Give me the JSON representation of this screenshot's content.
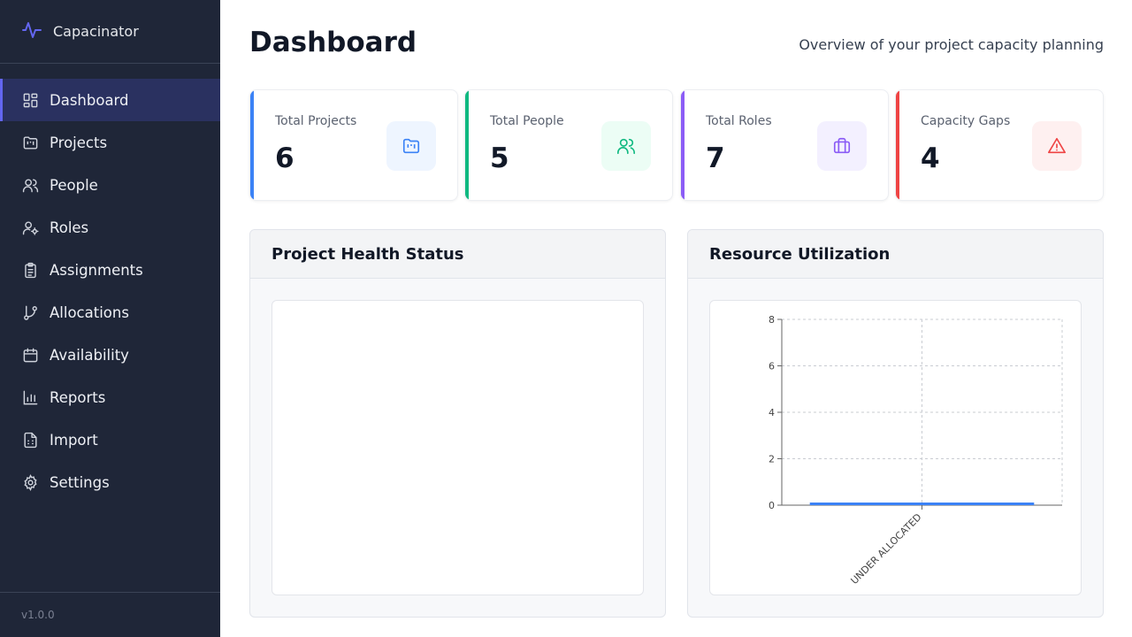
{
  "app": {
    "name": "Capacinator",
    "version": "v1.0.0",
    "accent": "#6366f1"
  },
  "sidebar": {
    "items": [
      {
        "label": "Dashboard",
        "icon": "dashboard-icon",
        "active": true
      },
      {
        "label": "Projects",
        "icon": "folder-kanban-icon"
      },
      {
        "label": "People",
        "icon": "users-icon"
      },
      {
        "label": "Roles",
        "icon": "user-cog-icon"
      },
      {
        "label": "Assignments",
        "icon": "clipboard-list-icon"
      },
      {
        "label": "Allocations",
        "icon": "git-branch-icon"
      },
      {
        "label": "Availability",
        "icon": "calendar-icon"
      },
      {
        "label": "Reports",
        "icon": "bar-chart-icon"
      },
      {
        "label": "Import",
        "icon": "file-spreadsheet-icon"
      },
      {
        "label": "Settings",
        "icon": "settings-icon"
      }
    ]
  },
  "header": {
    "title": "Dashboard",
    "subtitle": "Overview of your project capacity planning"
  },
  "stats": [
    {
      "label": "Total Projects",
      "value": "6",
      "icon": "folder-kanban-icon",
      "color": "#3b82f6",
      "bg": "#eef5ff"
    },
    {
      "label": "Total People",
      "value": "5",
      "icon": "users-icon",
      "color": "#10b981",
      "bg": "#ecfdf5"
    },
    {
      "label": "Total Roles",
      "value": "7",
      "icon": "briefcase-icon",
      "color": "#8b5cf6",
      "bg": "#f3f0ff"
    },
    {
      "label": "Capacity Gaps",
      "value": "4",
      "icon": "alert-triangle-icon",
      "color": "#ef4444",
      "bg": "#fef0f0"
    }
  ],
  "panels": {
    "health": {
      "title": "Project Health Status"
    },
    "utilization": {
      "title": "Resource Utilization"
    }
  },
  "chart_data": {
    "type": "bar",
    "categories": [
      "UNDER ALLOCATED"
    ],
    "values": [
      0
    ],
    "ylim": [
      0,
      8
    ],
    "yticks": [
      "0",
      "2",
      "4",
      "6",
      "8"
    ],
    "grid": true,
    "bar_color": "#3b82f6"
  }
}
